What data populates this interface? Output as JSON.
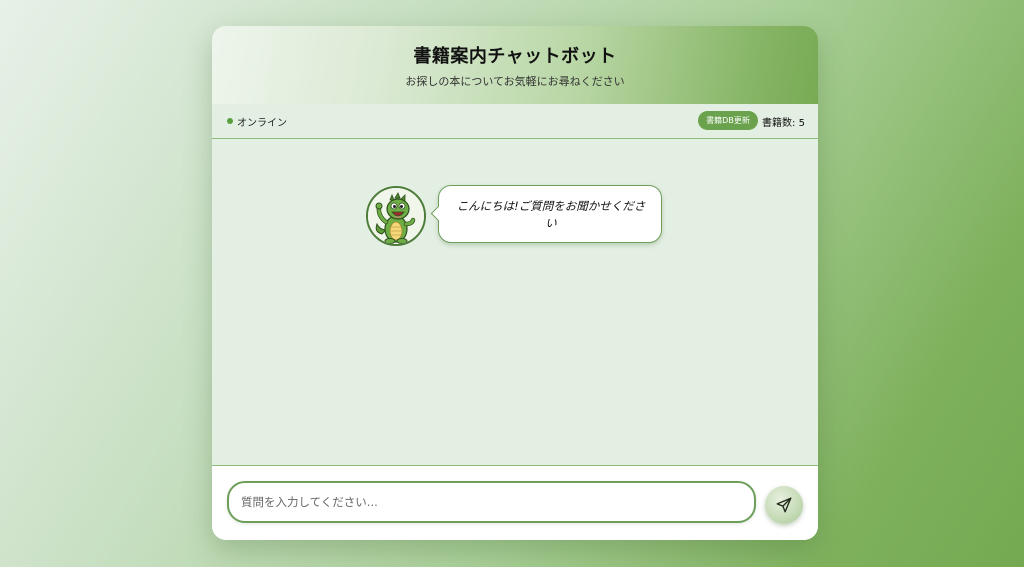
{
  "header": {
    "title": "書籍案内チャットボット",
    "subtitle": "お探しの本についてお気軽にお尋ねください"
  },
  "status": {
    "text": "オンライン",
    "db_update_label": "書籍DB更新",
    "book_count_label": "書籍数: ",
    "book_count_value": "5"
  },
  "chat": {
    "messages": [
      {
        "sender": "bot",
        "avatar_icon": "dinosaur-mascot-icon",
        "text": "こんにちは!ご質問をお聞かせください"
      }
    ]
  },
  "composer": {
    "placeholder": "質問を入力してください...",
    "value": "",
    "send_icon": "send-icon"
  },
  "colors": {
    "accent": "#6aa24d",
    "border": "#6d9f5a",
    "panel_bg": "#e3efe2"
  }
}
